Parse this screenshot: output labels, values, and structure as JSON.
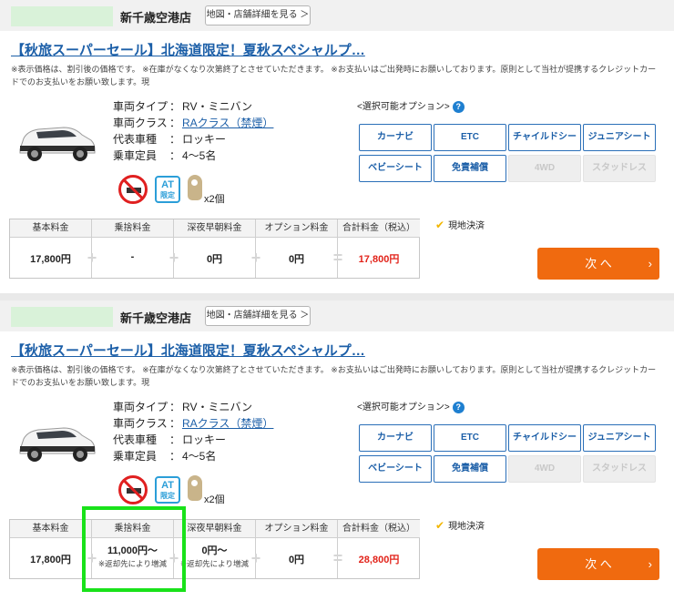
{
  "cards": [
    {
      "shop_name": "新千歳空港店",
      "map_button": "地図・店舗詳細を見る ＞",
      "plan_title": "【秋旅スーパーセール】北海道限定！夏秋スペシャルプ…",
      "note": "※表示価格は、割引後の価格です。 ※在庫がなくなり次第終了とさせていただきます。 ※お支払いはご出発時にお願いしております。原則として当社が提携するクレジットカードでのお支払いをお願い致します。現",
      "specs": [
        {
          "label": "車両タイプ",
          "colon": "：",
          "value": "RV・ミニバン",
          "link": false
        },
        {
          "label": "車両クラス",
          "colon": "：",
          "value": "RAクラス（禁煙）",
          "link": true
        },
        {
          "label": "代表車種",
          "colon": "：",
          "value": "ロッキー",
          "link": false
        },
        {
          "label": "乗車定員",
          "colon": "：",
          "value": "4～5名",
          "link": false
        }
      ],
      "at_badge": {
        "top": "AT",
        "bottom": "限定"
      },
      "key_count": "x2個",
      "options_title": "<選択可能オプション>",
      "help_glyph": "?",
      "options": [
        {
          "label": "カーナビ",
          "enabled": true
        },
        {
          "label": "ETC",
          "enabled": true
        },
        {
          "label": "チャイルドシート",
          "enabled": true
        },
        {
          "label": "ジュニアシート",
          "enabled": true
        },
        {
          "label": "ベビーシート",
          "enabled": true
        },
        {
          "label": "免責補償",
          "enabled": true
        },
        {
          "label": "4WD",
          "enabled": false
        },
        {
          "label": "スタッドレス",
          "enabled": false
        }
      ],
      "price_headers": [
        "基本料金",
        "乗捨料金",
        "深夜早朝料金",
        "オプション料金",
        "合計料金（税込）"
      ],
      "prices": [
        "17,800円",
        "-",
        "0円",
        "0円",
        "17,800円"
      ],
      "price_subs": [
        "",
        "",
        "",
        "",
        ""
      ],
      "operators": [
        "+",
        "+",
        "+",
        "="
      ],
      "pay_method": "現地決済",
      "next_button": "次 へ",
      "next_chevron": "›"
    },
    {
      "shop_name": "新千歳空港店",
      "map_button": "地図・店舗詳細を見る ＞",
      "plan_title": "【秋旅スーパーセール】北海道限定！夏秋スペシャルプ…",
      "note": "※表示価格は、割引後の価格です。 ※在庫がなくなり次第終了とさせていただきます。 ※お支払いはご出発時にお願いしております。原則として当社が提携するクレジットカードでのお支払いをお願い致します。現",
      "specs": [
        {
          "label": "車両タイプ",
          "colon": "：",
          "value": "RV・ミニバン",
          "link": false
        },
        {
          "label": "車両クラス",
          "colon": "：",
          "value": "RAクラス（禁煙）",
          "link": true
        },
        {
          "label": "代表車種",
          "colon": "：",
          "value": "ロッキー",
          "link": false
        },
        {
          "label": "乗車定員",
          "colon": "：",
          "value": "4～5名",
          "link": false
        }
      ],
      "at_badge": {
        "top": "AT",
        "bottom": "限定"
      },
      "key_count": "x2個",
      "options_title": "<選択可能オプション>",
      "help_glyph": "?",
      "options": [
        {
          "label": "カーナビ",
          "enabled": true
        },
        {
          "label": "ETC",
          "enabled": true
        },
        {
          "label": "チャイルドシート",
          "enabled": true
        },
        {
          "label": "ジュニアシート",
          "enabled": true
        },
        {
          "label": "ベビーシート",
          "enabled": true
        },
        {
          "label": "免責補償",
          "enabled": true
        },
        {
          "label": "4WD",
          "enabled": false
        },
        {
          "label": "スタッドレス",
          "enabled": false
        }
      ],
      "price_headers": [
        "基本料金",
        "乗捨料金",
        "深夜早朝料金",
        "オプション料金",
        "合計料金（税込）"
      ],
      "prices": [
        "17,800円",
        "11,000円～",
        "0円～",
        "0円",
        "28,800円"
      ],
      "price_subs": [
        "",
        "※返却先により増減",
        "※返却先により増減",
        "",
        ""
      ],
      "operators": [
        "+",
        "+",
        "+",
        "="
      ],
      "pay_method": "現地決済",
      "next_button": "次 へ",
      "next_chevron": "›"
    }
  ],
  "colors": {
    "accent_link": "#1c5fa8",
    "next_button": "#f06a0f",
    "total_price": "#e2231a",
    "highlight": "#19e21a"
  }
}
